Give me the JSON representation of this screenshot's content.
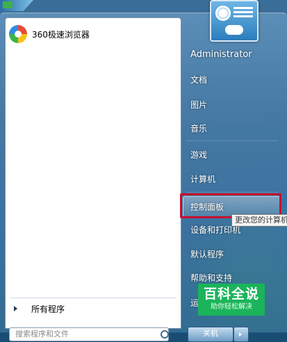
{
  "start_menu": {
    "pinned": [
      {
        "label": "360极速浏览器",
        "icon": "360-browser-icon"
      }
    ],
    "all_programs_label": "所有程序",
    "search": {
      "placeholder": "搜索程序和文件"
    },
    "right_items": [
      "Administrator",
      "文档",
      "图片",
      "音乐",
      "游戏",
      "计算机",
      "控制面板",
      "设备和打印机",
      "默认程序",
      "帮助和支持",
      "运行..."
    ],
    "tooltip": "更改您的计算机",
    "shutdown_label": "关机"
  },
  "watermark": {
    "title": "百科全说",
    "subtitle": "助你轻松解决"
  },
  "colors": {
    "highlight_outline": "#c8102e",
    "watermark_bg": "#1bb45b"
  }
}
